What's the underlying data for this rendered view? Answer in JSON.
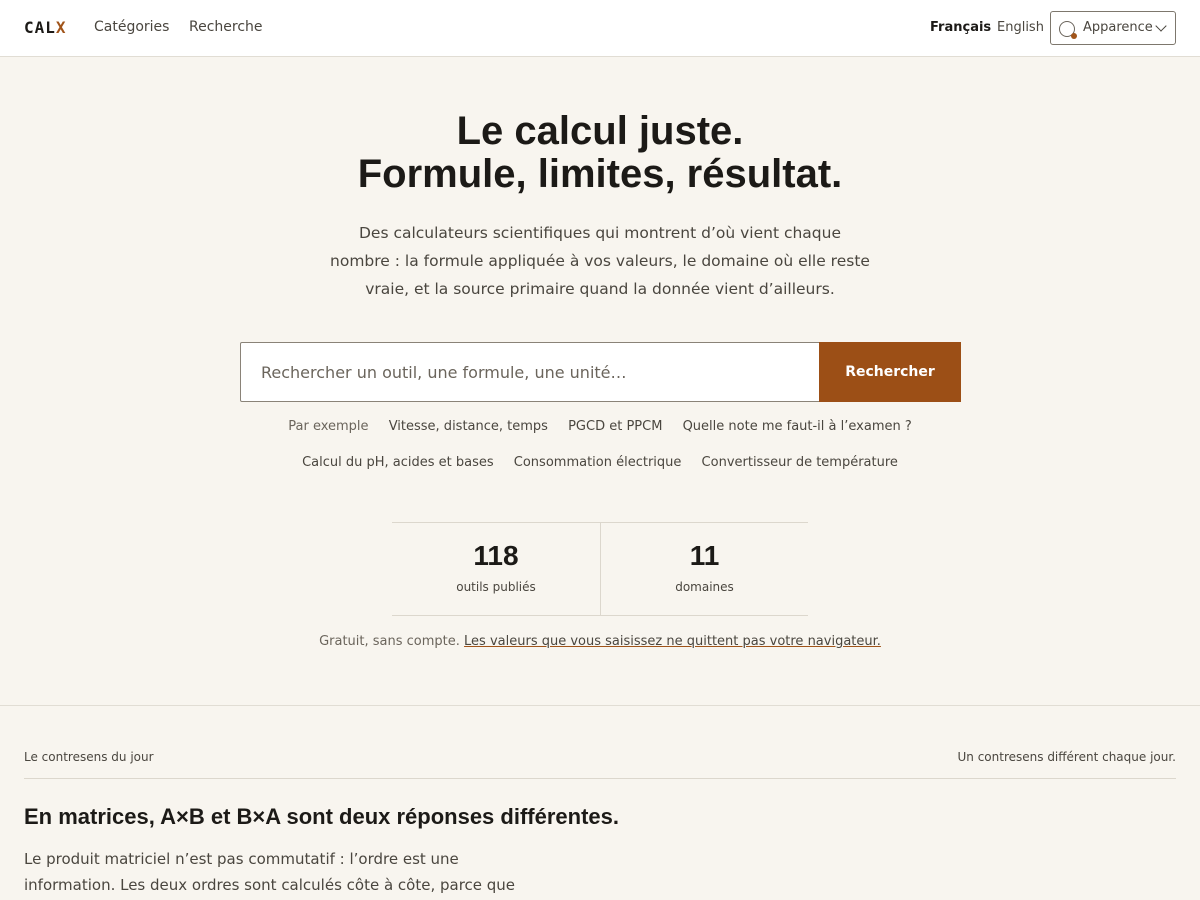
{
  "header": {
    "logo_main": "CAL",
    "logo_accent": "X",
    "nav": [
      "Catégories",
      "Recherche"
    ],
    "lang_current": "Français",
    "lang_other": "English",
    "appearance_label": "Apparence"
  },
  "hero": {
    "title_line1": "Le calcul juste.",
    "title_line2": "Formule, limites, résultat.",
    "subtitle": "Des calculateurs scientifiques qui montrent d’où vient chaque nombre : la formule appliquée à vos valeurs, le domaine où elle reste vraie, et la source primaire quand la donnée vient d’ailleurs.",
    "search_placeholder": "Rechercher un outil, une formule, une unité…",
    "search_button": "Rechercher",
    "examples_label": "Par exemple",
    "examples": [
      "Vitesse, distance, temps",
      "PGCD et PPCM",
      "Quelle note me faut-il à l’examen ?",
      "Calcul du pH, acides et bases",
      "Consommation électrique",
      "Convertisseur de température"
    ]
  },
  "stats": [
    {
      "value": "118",
      "label": "outils publiés"
    },
    {
      "value": "11",
      "label": "domaines"
    }
  ],
  "note": {
    "prefix": "Gratuit, sans compte.",
    "link": "Les valeurs que vous saisissez ne quittent pas votre navigateur."
  },
  "daily": {
    "label": "Le contresens du jour",
    "right_label": "Un contresens différent chaque jour.",
    "title": "En matrices, A×B et B×A sont deux réponses différentes.",
    "body": "Le produit matriciel n’est pas commutatif : l’ordre est une information. Les deux ordres sont calculés côte à côte, parce que"
  },
  "colors": {
    "accent": "#9c4f16",
    "background": "#f8f5ef"
  }
}
